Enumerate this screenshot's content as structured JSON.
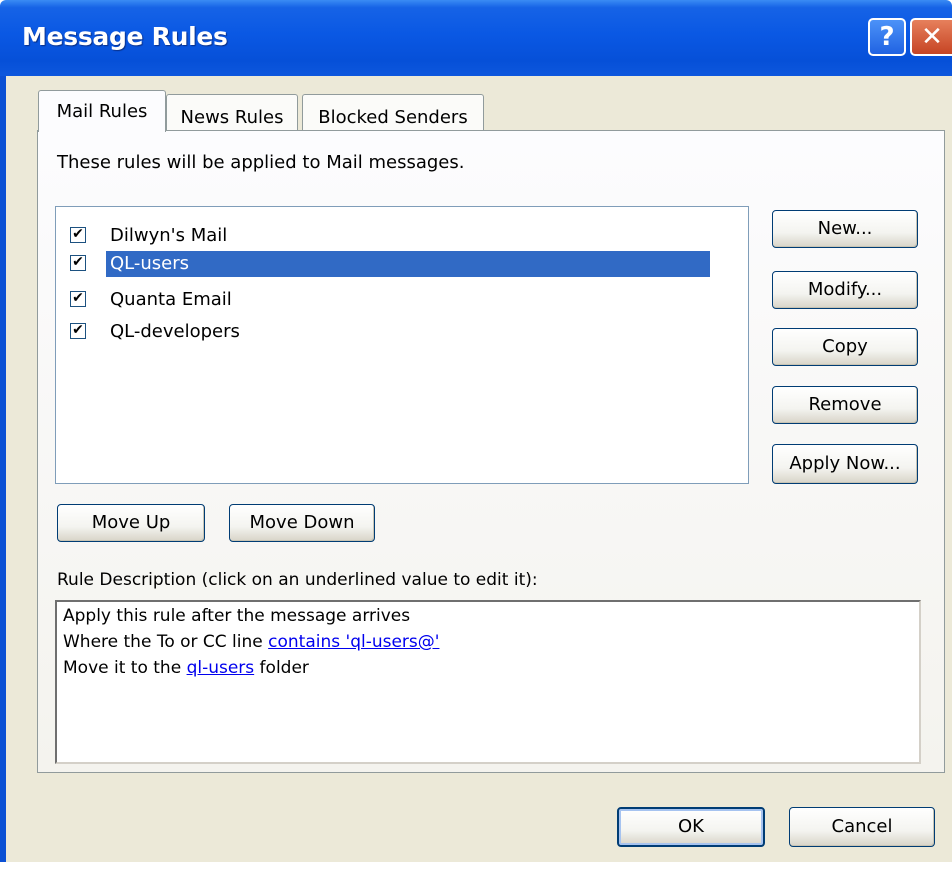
{
  "window": {
    "title": "Message Rules",
    "help_glyph": "?",
    "close_glyph": "✕"
  },
  "tabs": [
    {
      "label": "Mail Rules",
      "active": true
    },
    {
      "label": "News Rules",
      "active": false
    },
    {
      "label": "Blocked Senders",
      "active": false
    }
  ],
  "panel": {
    "intro": "These rules will be applied to Mail messages."
  },
  "rules": [
    {
      "label": "Dilwyn's Mail",
      "checked": true,
      "selected": false
    },
    {
      "label": "QL-users",
      "checked": true,
      "selected": true
    },
    {
      "label": "Quanta Email",
      "checked": true,
      "selected": false
    },
    {
      "label": "QL-developers",
      "checked": true,
      "selected": false
    }
  ],
  "checkmark": "✔",
  "side_buttons": {
    "new": "New...",
    "modify": "Modify...",
    "copy": "Copy",
    "remove": "Remove",
    "apply_now": "Apply Now..."
  },
  "move_buttons": {
    "up": "Move Up",
    "down": "Move Down"
  },
  "description": {
    "label": "Rule Description (click on an underlined value to edit it):",
    "line1": "Apply this rule after the message arrives",
    "line2_prefix": "Where the To or CC line ",
    "line2_link": "contains 'ql-users@'",
    "line3_prefix": "Move it to the ",
    "line3_link": "ql-users",
    "line3_suffix": " folder"
  },
  "footer": {
    "ok": "OK",
    "cancel": "Cancel"
  },
  "colors": {
    "title_bar": "#0a58e4",
    "selection": "#316ac5",
    "dialog_bg": "#ece9d8",
    "link": "#0000ee"
  }
}
